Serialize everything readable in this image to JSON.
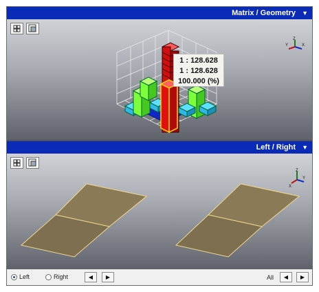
{
  "top_panel": {
    "title": "Matrix / Geometry",
    "chevron": "chevron-down-icon"
  },
  "bottom_panel": {
    "title": "Left / Right",
    "chevron": "chevron-down-icon"
  },
  "toolbar_icons": [
    "fit-view-icon",
    "zoom-icon"
  ],
  "tooltip": {
    "line1": "1 : 128.628",
    "line2": "1 : 128.628",
    "line3": "100.000 (%)"
  },
  "axis_labels": {
    "x": "X",
    "y": "Y",
    "z": "Z"
  },
  "statusbar": {
    "radio_left": "Left",
    "radio_right": "Right",
    "selected": "Left",
    "all_label": "All",
    "prev_glyph": "◀",
    "next_glyph": "▶"
  },
  "colors": {
    "titlebar": "#0a2bb6",
    "bar_green": "#7dff3c",
    "bar_cyan": "#2fd0ff",
    "bar_blue": "#1028c8",
    "bar_red": "#e01010",
    "highlight": "#ffd400",
    "surface": "#8a7a58",
    "surface_edge": "#f0d98a"
  }
}
